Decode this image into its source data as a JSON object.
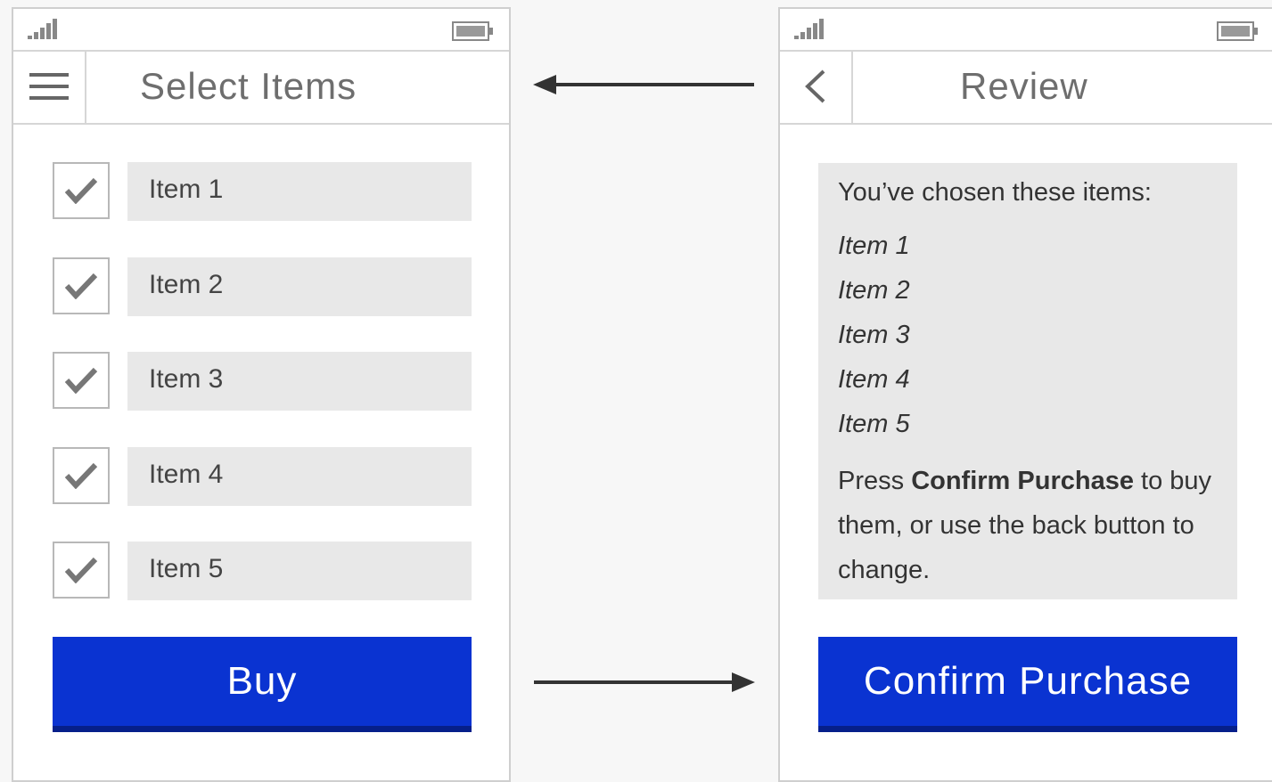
{
  "select_screen": {
    "title": "Select Items",
    "menu_icon": "hamburger-menu-icon",
    "items": [
      {
        "label": "Item 1",
        "checked": true
      },
      {
        "label": "Item 2",
        "checked": true
      },
      {
        "label": "Item 3",
        "checked": true
      },
      {
        "label": "Item 4",
        "checked": true
      },
      {
        "label": "Item 5",
        "checked": true
      }
    ],
    "buy_label": "Buy"
  },
  "review_screen": {
    "title": "Review",
    "back_icon": "chevron-left-icon",
    "intro": "You’ve chosen these items:",
    "items": [
      "Item 1",
      "Item 2",
      "Item 3",
      "Item 4",
      "Item 5"
    ],
    "instructions_prefix": "Press ",
    "instructions_bold": "Confirm Purchase",
    "instructions_suffix": " to buy them, or use the back button to change.",
    "confirm_label": "Confirm Purchase"
  },
  "colors": {
    "primary": "#0a33d1",
    "primary_shadow": "#061f8a",
    "field_bg": "#e8e8e8",
    "background": "#f7f7f7"
  }
}
